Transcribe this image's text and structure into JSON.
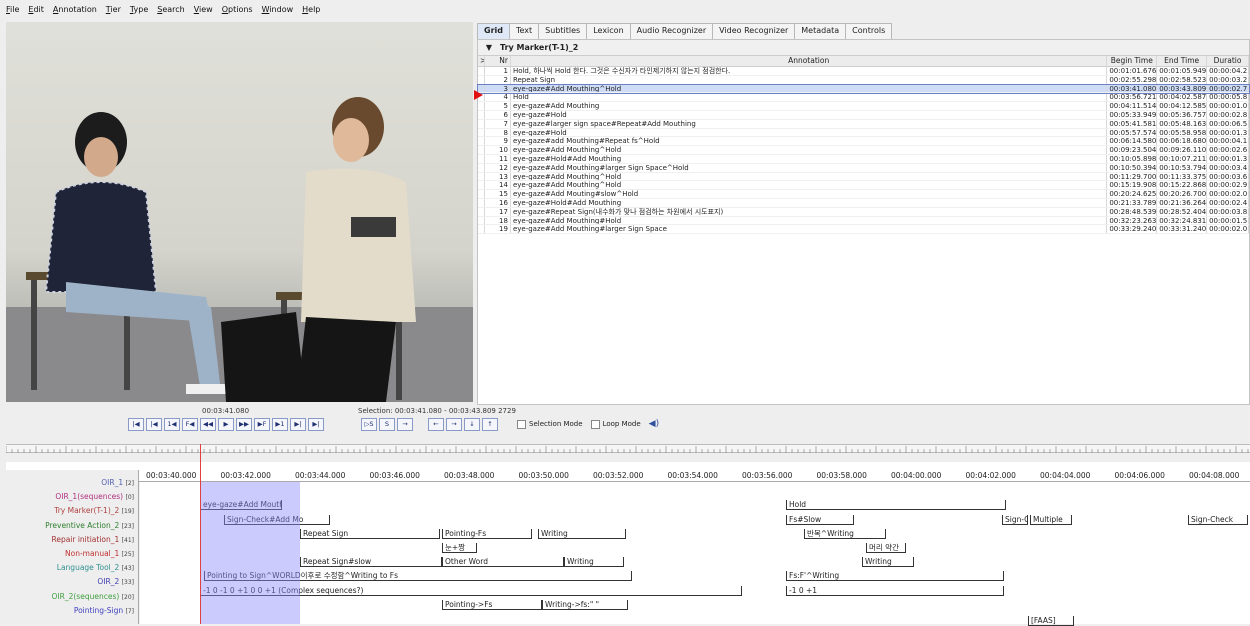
{
  "menu": [
    "File",
    "Edit",
    "Annotation",
    "Tier",
    "Type",
    "Search",
    "View",
    "Options",
    "Window",
    "Help"
  ],
  "tabs": [
    "Grid",
    "Text",
    "Subtitles",
    "Lexicon",
    "Audio Recognizer",
    "Video Recognizer",
    "Metadata",
    "Controls"
  ],
  "grid": {
    "tier_name": "Try Marker(T-1)_2",
    "headers": {
      "sel": ">",
      "nr": "Nr",
      "annotation": "Annotation",
      "begin": "Begin Time",
      "end": "End Time",
      "duration": "Duratio"
    },
    "rows": [
      {
        "nr": "1",
        "annotation": "Hold, 하나씩 Hold 한다. 그것은 수신자가 타인제기하지 않는지 점검한다.",
        "begin": "00:01:01.676",
        "end": "00:01:05.949",
        "dur": "00:00:04.2"
      },
      {
        "nr": "2",
        "annotation": "Repeat Sign",
        "begin": "00:02:55.298",
        "end": "00:02:58.523",
        "dur": "00:00:03.2"
      },
      {
        "nr": "3",
        "annotation": "eye-gaze#Add Mouthing^Hold",
        "begin": "00:03:41.080",
        "end": "00:03:43.809",
        "dur": "00:00:02.7"
      },
      {
        "nr": "4",
        "annotation": "Hold",
        "begin": "00:03:56.721",
        "end": "00:04:02.587",
        "dur": "00:00:05.8"
      },
      {
        "nr": "5",
        "annotation": "eye-gaze#Add Mouthing",
        "begin": "00:04:11.514",
        "end": "00:04:12.585",
        "dur": "00:00:01.0"
      },
      {
        "nr": "6",
        "annotation": "eye-gaze#Hold",
        "begin": "00:05:33.949",
        "end": "00:05:36.757",
        "dur": "00:00:02.8"
      },
      {
        "nr": "7",
        "annotation": "eye-gaze#larger sign space#Repeat#Add Mouthing",
        "begin": "00:05:41.581",
        "end": "00:05:48.163",
        "dur": "00:00:06.5"
      },
      {
        "nr": "8",
        "annotation": "eye-gaze#Hold",
        "begin": "00:05:57.574",
        "end": "00:05:58.958",
        "dur": "00:00:01.3"
      },
      {
        "nr": "9",
        "annotation": "eye-gaze#add Mouthing#Repeat fs^Hold",
        "begin": "00:06:14.580",
        "end": "00:06:18.680",
        "dur": "00:00:04.1"
      },
      {
        "nr": "10",
        "annotation": "eye-gaze#Add Mouthing^Hold",
        "begin": "00:09:23.504",
        "end": "00:09:26.110",
        "dur": "00:00:02.6"
      },
      {
        "nr": "11",
        "annotation": "eye-gaze#Hold#Add Mouthing",
        "begin": "00:10:05.898",
        "end": "00:10:07.211",
        "dur": "00:00:01.3"
      },
      {
        "nr": "12",
        "annotation": "eye-gaze#Add Mouthing#larger Sign Space^Hold",
        "begin": "00:10:50.394",
        "end": "00:10:53.794",
        "dur": "00:00:03.4"
      },
      {
        "nr": "13",
        "annotation": "eye-gaze#Add Mouthing^Hold",
        "begin": "00:11:29.700",
        "end": "00:11:33.375",
        "dur": "00:00:03.6"
      },
      {
        "nr": "14",
        "annotation": "eye-gaze#Add Mouthing^Hold",
        "begin": "00:15:19.908",
        "end": "00:15:22.868",
        "dur": "00:00:02.9"
      },
      {
        "nr": "15",
        "annotation": "eye-gaze#Add Mouting#slow^Hold",
        "begin": "00:20:24.625",
        "end": "00:20:26.700",
        "dur": "00:00:02.0"
      },
      {
        "nr": "16",
        "annotation": "eye-gaze#Hold#Add Mouthing",
        "begin": "00:21:33.789",
        "end": "00:21:36.264",
        "dur": "00:00:02.4"
      },
      {
        "nr": "17",
        "annotation": "eye-gaze#Repeat Sign(내수화가 맞나 점검하는 차원에서 시도표지)",
        "begin": "00:28:48.539",
        "end": "00:28:52.404",
        "dur": "00:00:03.8"
      },
      {
        "nr": "18",
        "annotation": "eye-gaze#Add Mouthing#Hold",
        "begin": "00:32:23.263",
        "end": "00:32:24.831",
        "dur": "00:00:01.5"
      },
      {
        "nr": "19",
        "annotation": "eye-gaze#Add Mouthing#larger Sign Space",
        "begin": "00:33:29.240",
        "end": "00:33:31.240",
        "dur": "00:00:02.0"
      }
    ]
  },
  "media": {
    "current_time": "00:03:41.080",
    "selection": "Selection: 00:03:41.080 - 00:03:43.809  2729",
    "selection_mode": "Selection Mode",
    "loop_mode": "Loop Mode",
    "player_buttons": [
      "|◀",
      "|◀",
      "1◀",
      "F◀",
      "◀◀",
      "▶",
      "▶▶",
      "▶F",
      "▶1",
      "▶|",
      "▶|"
    ],
    "sel_buttons": [
      "▷S",
      "S",
      "→"
    ],
    "nav_buttons": [
      "←",
      "→",
      "↓",
      "↑"
    ]
  },
  "ruler_ticks": [
    "00:03:40.000",
    "00:03:42.000",
    "00:03:44.000",
    "00:03:46.000",
    "00:03:48.000",
    "00:03:50.000",
    "00:03:52.000",
    "00:03:54.000",
    "00:03:56.000",
    "00:03:58.000",
    "00:04:00.000",
    "00:04:02.000",
    "00:04:04.000",
    "00:04:06.000",
    "00:04:08.000"
  ],
  "tiers": [
    {
      "name": "OIR_1",
      "count": "[2]",
      "color": "#5060b0"
    },
    {
      "name": "OIR_1(sequences)",
      "count": "[0]",
      "color": "#b03080"
    },
    {
      "name": "Try Marker(T-1)_2",
      "count": "[19]",
      "color": "#b04040"
    },
    {
      "name": "Preventive Action_2",
      "count": "[23]",
      "color": "#308030"
    },
    {
      "name": "Repair initiation_1",
      "count": "[41]",
      "color": "#a03030"
    },
    {
      "name": "Non-manual_1",
      "count": "[25]",
      "color": "#c03030"
    },
    {
      "name": "Language Tool_2",
      "count": "[43]",
      "color": "#309090"
    },
    {
      "name": "OIR_2",
      "count": "[33]",
      "color": "#4040b0"
    },
    {
      "name": "OIR_2(sequences)",
      "count": "[20]",
      "color": "#40a040"
    },
    {
      "name": "Pointing-Sign",
      "count": "[7]",
      "color": "#4040c0"
    }
  ],
  "annotations": [
    {
      "tier": 2,
      "label": "eye-gaze#Add Mouthing^H"
    },
    {
      "tier": 2,
      "label": "Hold"
    },
    {
      "tier": 3,
      "label": "Sign-Check#Add Mo"
    },
    {
      "tier": 3,
      "label": "Fs#Slow"
    },
    {
      "tier": 3,
      "label": "Sign-C"
    },
    {
      "tier": 3,
      "label": "Multiple"
    },
    {
      "tier": 3,
      "label": "Sign-Check"
    },
    {
      "tier": 4,
      "label": "Repeat Sign"
    },
    {
      "tier": 4,
      "label": "Pointing-Fs"
    },
    {
      "tier": 4,
      "label": "Writing"
    },
    {
      "tier": 4,
      "label": "반복^Writing"
    },
    {
      "tier": 5,
      "label": "눈+짱"
    },
    {
      "tier": 5,
      "label": "머리 약간"
    },
    {
      "tier": 6,
      "label": "Repeat Sign#slow"
    },
    {
      "tier": 6,
      "label": "Other Word"
    },
    {
      "tier": 6,
      "label": "Writing"
    },
    {
      "tier": 6,
      "label": "Writing"
    },
    {
      "tier": 7,
      "label": "Pointing to Sign^WORLD이후로 수정함^Writing to Fs"
    },
    {
      "tier": 7,
      "label": "Fs:F'^Writing"
    },
    {
      "tier": 8,
      "label": "-1        0  -1                    0        +1        0  0 +1   (Complex sequences?)"
    },
    {
      "tier": 8,
      "label": "-1          0  +1"
    },
    {
      "tier": 9,
      "label": "Pointing->Fs"
    },
    {
      "tier": 9,
      "label": "Writing->fs:\" \""
    },
    {
      "tier": 10,
      "label": "[FAAS]"
    }
  ]
}
